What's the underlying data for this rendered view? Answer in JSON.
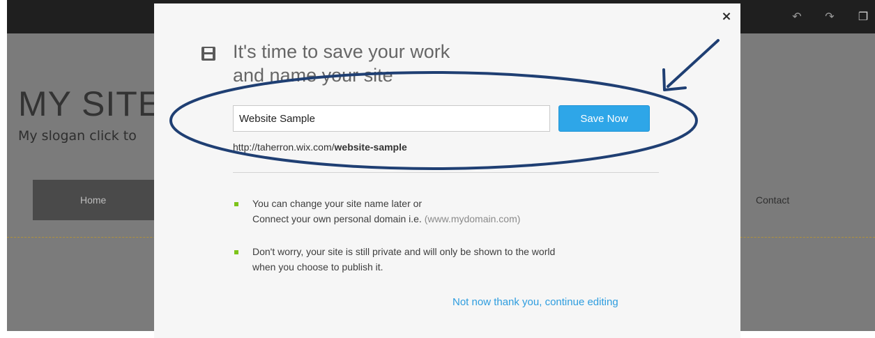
{
  "editor": {
    "site_title": "MY SITE",
    "site_slogan": "My slogan click to",
    "nav_home": "Home",
    "nav_contact": "Contact",
    "toolbar_icons": [
      "undo-icon",
      "redo-icon",
      "copy-icon"
    ]
  },
  "modal": {
    "close_label": "×",
    "heading_line1": "It's time to save your work",
    "heading_line2": "and name your site",
    "site_name_value": "Website Sample",
    "save_button": "Save Now",
    "url_prefix": "http://taherron.wix.com/",
    "url_slug": "website-sample",
    "info1_line1": "You can change your site name later or",
    "info1_line2": "Connect your own personal domain i.e. ",
    "info1_domain": "(www.mydomain.com)",
    "info2_line1": "Don't worry, your site is still private and will only be shown to the world",
    "info2_line2": "when you choose to publish it.",
    "continue_link": "Not now thank you, continue editing"
  },
  "colors": {
    "accent": "#2ea6e8",
    "bullet": "#7dc31a",
    "annotation": "#1f3f73"
  }
}
